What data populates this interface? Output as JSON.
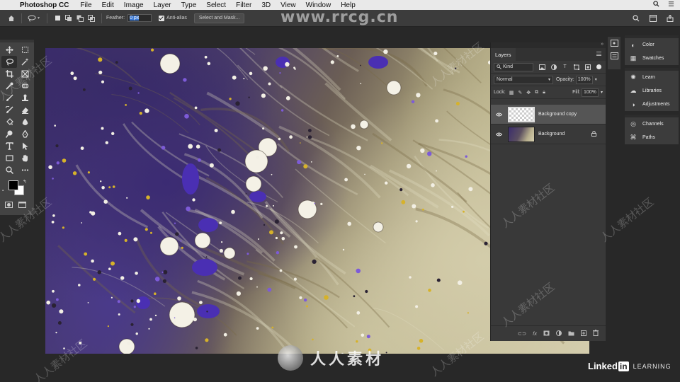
{
  "menubar": {
    "app_name": "Photoshop CC",
    "items": [
      "File",
      "Edit",
      "Image",
      "Layer",
      "Type",
      "Select",
      "Filter",
      "3D",
      "View",
      "Window",
      "Help"
    ]
  },
  "options_bar": {
    "feather_label": "Feather:",
    "feather_value": "0 px",
    "anti_alias_label": "Anti-alias",
    "anti_alias_checked": true,
    "select_and_mask_label": "Select and Mask..."
  },
  "tools": [
    "move-tool",
    "artboard-tool",
    "lasso-tool",
    "magic-wand-tool",
    "crop-tool",
    "frame-tool",
    "eyedropper-tool",
    "patch-tool",
    "brush-tool",
    "clone-stamp-tool",
    "history-brush-tool",
    "eraser-tool",
    "paint-bucket-tool",
    "blur-tool",
    "dodge-tool",
    "pen-tool",
    "type-tool",
    "path-selection-tool",
    "rectangle-tool",
    "hand-tool",
    "zoom-tool",
    "more-tools"
  ],
  "active_tool": "lasso-tool",
  "colors": {
    "foreground": "#000000",
    "background": "#ffffff"
  },
  "layers_panel": {
    "tab_label": "Layers",
    "filter_kind": "Kind",
    "blend_mode": "Normal",
    "opacity_label": "Opacity:",
    "opacity_value": "100%",
    "lock_label": "Lock:",
    "fill_label": "Fill:",
    "fill_value": "100%",
    "layers": [
      {
        "name": "Background copy",
        "selected": true,
        "locked": false,
        "thumb": "transparent"
      },
      {
        "name": "Background",
        "selected": false,
        "locked": true,
        "thumb": "photo"
      }
    ]
  },
  "dock": {
    "group1": [
      "Color",
      "Swatches"
    ],
    "group2": [
      "Learn",
      "Libraries",
      "Adjustments"
    ],
    "group3": [
      "Channels",
      "Paths"
    ]
  },
  "watermark": {
    "url": "www.rrcg.cn",
    "cn_text": "人人素材社区",
    "logo_text": "人人素材"
  },
  "branding": {
    "linked": "Linked",
    "in": "in",
    "learning": "LEARNING"
  }
}
